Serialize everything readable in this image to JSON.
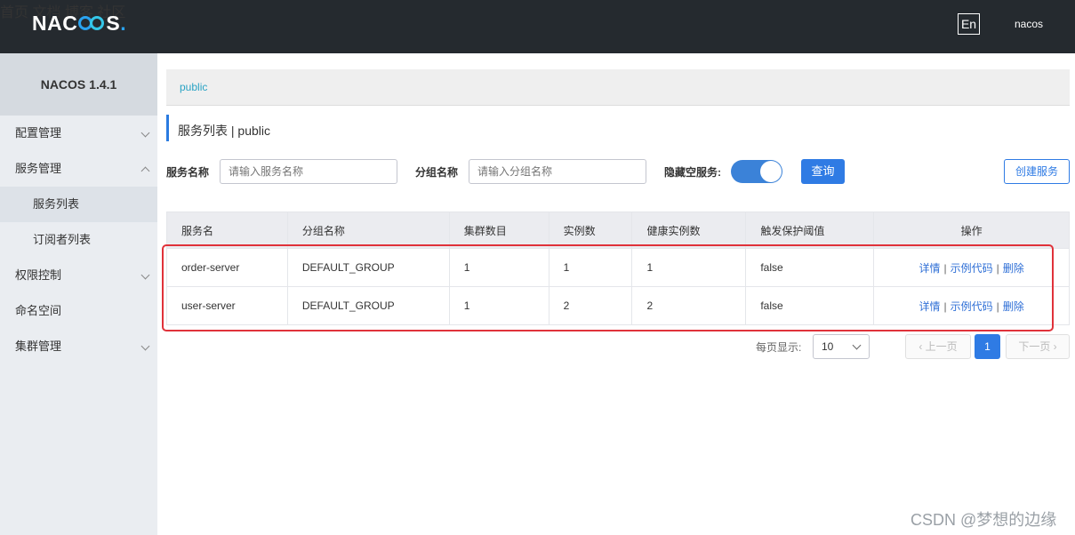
{
  "header": {
    "logo": "NACOS.",
    "nav": [
      "首页",
      "文档",
      "博客",
      "社区"
    ],
    "lang": "En",
    "user": "nacos"
  },
  "sidebar": {
    "title": "NACOS 1.4.1",
    "items": [
      {
        "label": "配置管理",
        "chevron": "down"
      },
      {
        "label": "服务管理",
        "chevron": "up"
      },
      {
        "label": "服务列表",
        "sub": true,
        "active": true
      },
      {
        "label": "订阅者列表",
        "sub": true
      },
      {
        "label": "权限控制",
        "chevron": "down"
      },
      {
        "label": "命名空间"
      },
      {
        "label": "集群管理",
        "chevron": "down"
      }
    ]
  },
  "breadcrumb": "public",
  "page_title": "服务列表  |  public",
  "filters": {
    "service_name_label": "服务名称",
    "service_name_placeholder": "请输入服务名称",
    "group_name_label": "分组名称",
    "group_name_placeholder": "请输入分组名称",
    "hide_empty_label": "隐藏空服务:",
    "hide_empty_on": true,
    "query_button": "查询",
    "create_button": "创建服务"
  },
  "table": {
    "columns": [
      "服务名",
      "分组名称",
      "集群数目",
      "实例数",
      "健康实例数",
      "触发保护阈值",
      "操作"
    ],
    "rows": [
      {
        "name": "order-server",
        "group": "DEFAULT_GROUP",
        "clusters": "1",
        "instances": "1",
        "healthy": "1",
        "threshold": "false"
      },
      {
        "name": "user-server",
        "group": "DEFAULT_GROUP",
        "clusters": "1",
        "instances": "2",
        "healthy": "2",
        "threshold": "false"
      }
    ],
    "actions": {
      "detail": "详情",
      "sample": "示例代码",
      "delete": "删除",
      "separator": "|"
    }
  },
  "pagination": {
    "page_size_label": "每页显示:",
    "page_size": "10",
    "prev": "上一页",
    "current": "1",
    "next": "下一页"
  },
  "watermark": "CSDN @梦想的边缘",
  "colors": {
    "accent": "#2f7be4",
    "highlight_border": "#e0323a",
    "topbar": "#252a2f"
  }
}
